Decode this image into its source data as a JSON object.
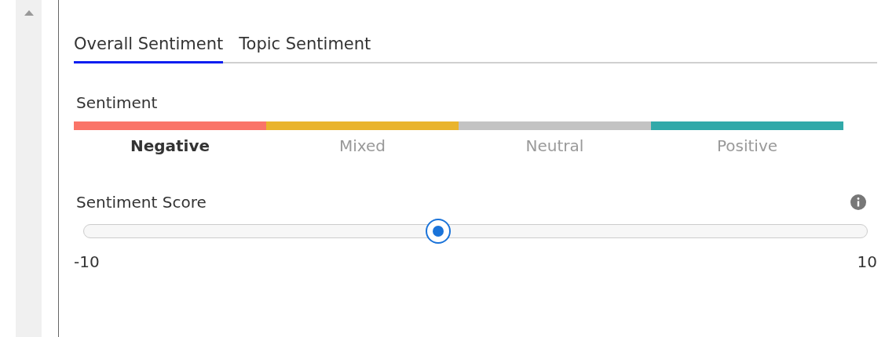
{
  "tabs": [
    {
      "label": "Overall Sentiment",
      "selected": true
    },
    {
      "label": "Topic Sentiment",
      "selected": false
    }
  ],
  "sentiment": {
    "label": "Sentiment",
    "segments": [
      {
        "label": "Negative",
        "color": "#fa7468",
        "selected": true
      },
      {
        "label": "Mixed",
        "color": "#e9b42d",
        "selected": false
      },
      {
        "label": "Neutral",
        "color": "#c3c3c3",
        "selected": false
      },
      {
        "label": "Positive",
        "color": "#31a9a9",
        "selected": false
      }
    ]
  },
  "score": {
    "label": "Sentiment Score",
    "level": 0.452,
    "min": "-10",
    "max": "10"
  }
}
